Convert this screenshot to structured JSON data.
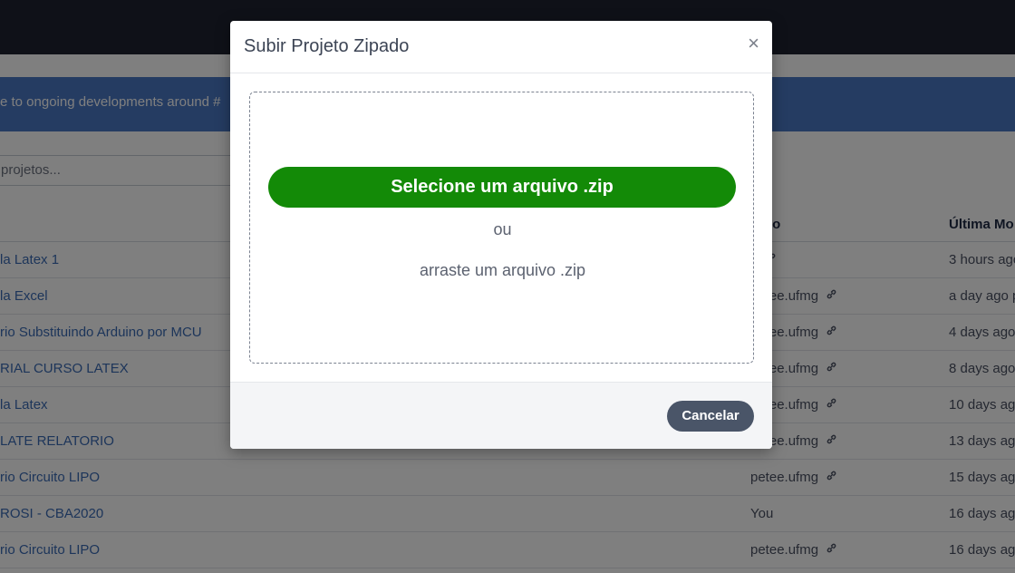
{
  "banner": {
    "text": "e to ongoing developments around #"
  },
  "search": {
    "value": "projetos..."
  },
  "table": {
    "headers": {
      "owner": "no",
      "modified": "Última Mo"
    },
    "rows": [
      {
        "name": "la Latex 1",
        "owner": "v",
        "modified": "3 hours ago",
        "shared": true
      },
      {
        "name": "la Excel",
        "owner": "petee.ufmg",
        "modified": "a day ago p",
        "shared": true
      },
      {
        "name": "rio Substituindo Arduino por MCU",
        "owner": "petee.ufmg",
        "modified": "4 days ago",
        "shared": true
      },
      {
        "name": "RIAL CURSO LATEX",
        "owner": "petee.ufmg",
        "modified": "8 days ago",
        "shared": true
      },
      {
        "name": "la Latex",
        "owner": "petee.ufmg",
        "modified": "10 days ago",
        "shared": true
      },
      {
        "name": "LATE RELATORIO",
        "owner": "petee.ufmg",
        "modified": "13 days ago",
        "shared": true
      },
      {
        "name": "rio Circuito LIPO",
        "owner": "petee.ufmg",
        "modified": "15 days ago",
        "shared": true
      },
      {
        "name": "ROSI - CBA2020",
        "owner": "You",
        "modified": "16 days ago",
        "shared": false
      },
      {
        "name": "rio Circuito LIPO",
        "owner": "petee.ufmg",
        "modified": "16 days ago",
        "shared": true
      }
    ]
  },
  "modal": {
    "title": "Subir Projeto Zipado",
    "close_symbol": "×",
    "select_button": "Selecione um arquivo .zip",
    "or_text": "ou",
    "drag_text": "arraste um arquivo .zip",
    "cancel_button": "Cancelar"
  },
  "colors": {
    "accent_green": "#138a07",
    "banner_blue": "#4b78c4",
    "cancel_gray": "#4a5568"
  },
  "icons": {
    "link": "link-icon"
  }
}
